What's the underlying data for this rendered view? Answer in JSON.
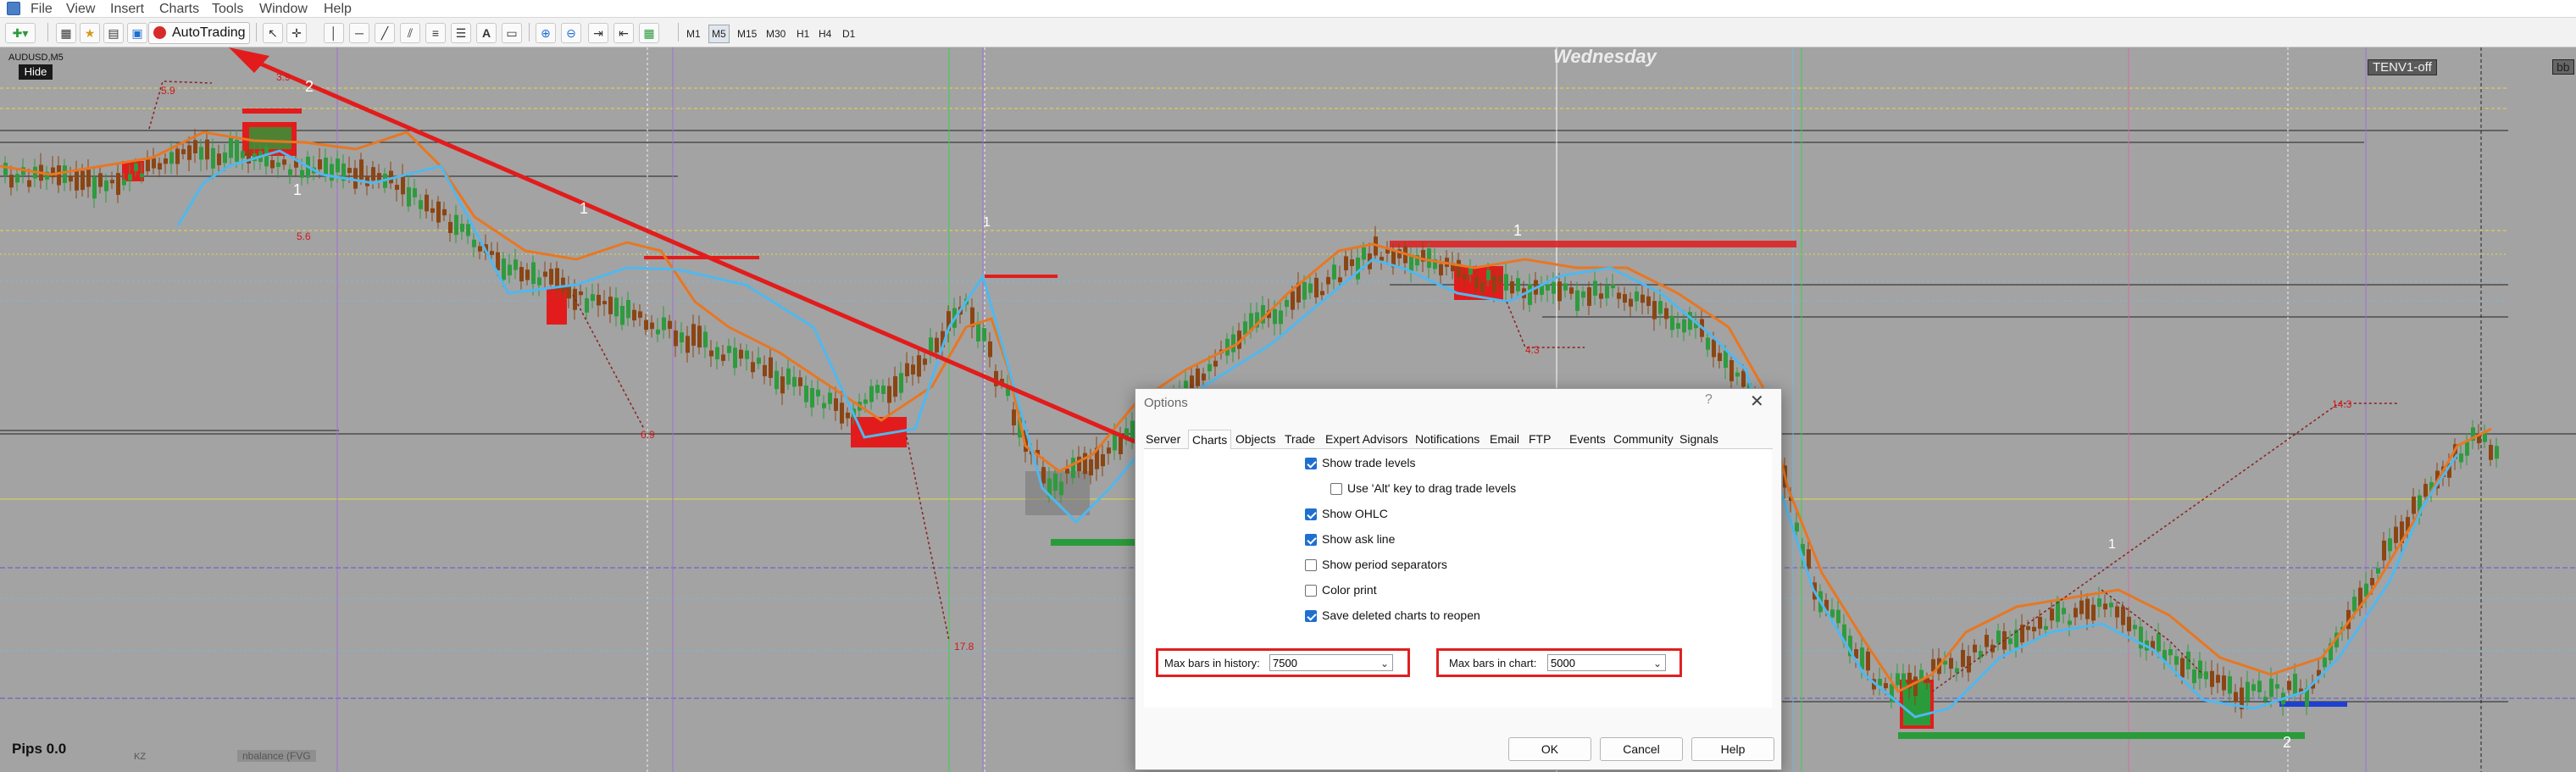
{
  "menubar": {
    "items": [
      "File",
      "View",
      "Insert",
      "Charts",
      "Tools",
      "Window",
      "Help"
    ]
  },
  "toolbar": {
    "autotrading_label": "AutoTrading",
    "timeframes": [
      "M1",
      "M5",
      "M15",
      "M30",
      "H1",
      "H4",
      "D1"
    ],
    "active_timeframe": "M5"
  },
  "chart": {
    "symbol": "AUDUSD,M5",
    "hide_button": "Hide",
    "weekday": "Wednesday",
    "indicator_label": "TENV1-off",
    "bb_label": "bb",
    "pips_label": "Pips 0.0",
    "kz_label": "KZ",
    "pvg_label": "nbalance (FVG",
    "annotations": [
      "5.9",
      "3.9",
      "2",
      "1",
      "5.6",
      "1",
      "6.9",
      "1",
      "17.8",
      "1",
      "4.3",
      "14.3",
      "2",
      "1"
    ],
    "colors": {
      "background": "#a3a3a3",
      "bull_candle": "#2e9b3e",
      "bear_candle": "#8b4513",
      "fast_line": "#4fb8ef",
      "slow_line": "#e87722",
      "highlight": "#e02020"
    }
  },
  "dialog": {
    "title": "Options",
    "help_glyph": "?",
    "close_glyph": "✕",
    "tabs": [
      "Server",
      "Charts",
      "Objects",
      "Trade",
      "Expert Advisors",
      "Notifications",
      "Email",
      "FTP",
      "Events",
      "Community",
      "Signals"
    ],
    "active_tab": "Charts",
    "options": [
      {
        "label": "Show trade levels",
        "checked": true
      },
      {
        "label": "Use 'Alt' key to drag trade levels",
        "checked": false
      },
      {
        "label": "Show OHLC",
        "checked": true
      },
      {
        "label": "Show ask line",
        "checked": true
      },
      {
        "label": "Show period separators",
        "checked": false
      },
      {
        "label": "Color print",
        "checked": false
      },
      {
        "label": "Save deleted charts to reopen",
        "checked": true
      }
    ],
    "max_bars_history": {
      "label": "Max bars in history:",
      "value": "7500"
    },
    "max_bars_chart": {
      "label": "Max bars in chart:",
      "value": "5000"
    },
    "buttons": {
      "ok": "OK",
      "cancel": "Cancel",
      "help": "Help"
    }
  }
}
